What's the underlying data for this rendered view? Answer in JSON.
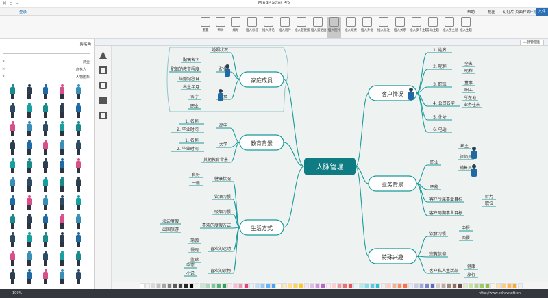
{
  "window": {
    "title": "MindMaster Pro"
  },
  "tabs": [
    "文件",
    "开始",
    "页面样式",
    "幻灯片",
    "视图",
    "帮助"
  ],
  "ribbon": [
    {
      "label": "插入主题"
    },
    {
      "label": "插入子主题"
    },
    {
      "label": "浮动主题"
    },
    {
      "label": "插入多个主题"
    },
    {
      "label": "插入关系"
    },
    {
      "label": "插入标注"
    },
    {
      "label": "插入外框"
    },
    {
      "label": "插入概要"
    },
    {
      "label": "插入图片"
    },
    {
      "label": "插入剪贴画"
    },
    {
      "label": "插入超链接"
    },
    {
      "label": "插入附件"
    },
    {
      "label": "插入评论"
    },
    {
      "label": "插入标签"
    },
    {
      "label": "编号"
    },
    {
      "label": "布局"
    },
    {
      "label": "重置"
    }
  ],
  "account": {
    "label": "登录"
  },
  "doc_tab": {
    "label": "人脉管理图"
  },
  "left_panel": {
    "title": "剪贴画",
    "categories": [
      "商业",
      "商务人士",
      "人物形象"
    ]
  },
  "status": {
    "zoom": "100%",
    "url": "http://www.edrawsoft.cn"
  },
  "mindmap": {
    "root": "人脉管理",
    "right": [
      {
        "title": "客户情况",
        "items": [
          "1. 姓名",
          "2. 昵称",
          "3. 职位",
          "4. 公司名字",
          "5. 住址",
          "6. 电话"
        ],
        "sub": {
          "nick": [
            "全名",
            "昵称"
          ],
          "pos": [
            "董事",
            "职工"
          ],
          "company": [
            "所在地",
            "业务往来"
          ]
        }
      },
      {
        "title": "业务背景",
        "items": [
          "职业",
          "职能",
          "客户所属事业目标",
          "客户周期事业目标"
        ],
        "sub": {
          "job": [
            "雇主",
            "律师员",
            "销售员"
          ],
          "goal": [
            "财力",
            "职位"
          ]
        }
      },
      {
        "title": "特殊兴趣",
        "items": [
          "饮食习惯",
          "宗教信仰",
          "客户私人生活部"
        ],
        "sub": {
          "food": [
            "中餐",
            "西餐"
          ],
          "life": [
            "健康",
            "旅行"
          ]
        }
      }
    ],
    "left": [
      {
        "title": "家庭成员",
        "items": [
          "婚姻状况",
          "配偶",
          "子女"
        ],
        "sub": {
          "spouse": [
            "配偶名字",
            "配偶的教育程度",
            "结婚纪念日"
          ],
          "kid": [
            "出生年月",
            "名字",
            "职业"
          ]
        }
      },
      {
        "title": "教育背景",
        "items": [
          "高中",
          "大学",
          "其他教育背景"
        ],
        "sub": {
          "hs": [
            "1. 名称",
            "2. 毕业时间"
          ],
          "uni": [
            "1. 名称",
            "2. 毕业时间"
          ]
        }
      },
      {
        "title": "生活方式",
        "items": [
          "健康状况",
          "饮酒习惯",
          "吸烟习惯",
          "喜欢的度假方式",
          "喜欢的运动",
          "喜欢的读物"
        ],
        "sub": {
          "health": [
            "良好",
            "一般"
          ],
          "vac": [
            "海边度假",
            "出国旅游"
          ],
          "sport": [
            "瑜伽",
            "慢跑",
            "篮球"
          ],
          "read": [
            "杂志",
            "小说"
          ]
        }
      }
    ]
  },
  "colors": {
    "root": "#0f7b82",
    "accent": "#2d6fb3",
    "branch": "#189a9a",
    "status": "#34373d"
  }
}
